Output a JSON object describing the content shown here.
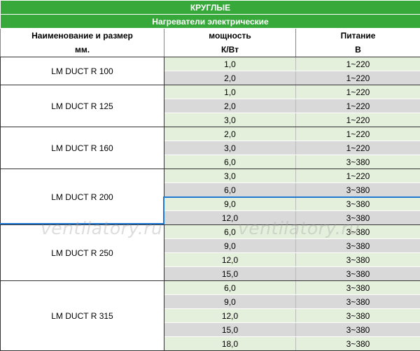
{
  "title": "КРУГЛЫЕ",
  "subtitle": "Нагреватели электрические",
  "headers": {
    "name_line1": "Наименование и размер",
    "name_line2": "мм.",
    "power_line1": "мощность",
    "power_line2": "К/Вт",
    "supply_line1": "Питание",
    "supply_line2": "В"
  },
  "groups": [
    {
      "name": "LM DUCT R 100",
      "rows": [
        {
          "power": "1,0",
          "supply": "1~220"
        },
        {
          "power": "2,0",
          "supply": "1~220"
        }
      ]
    },
    {
      "name": "LM DUCT R 125",
      "rows": [
        {
          "power": "1,0",
          "supply": "1~220"
        },
        {
          "power": "2,0",
          "supply": "1~220"
        },
        {
          "power": "3,0",
          "supply": "1~220"
        }
      ]
    },
    {
      "name": "LM DUCT R 160",
      "rows": [
        {
          "power": "2,0",
          "supply": "1~220"
        },
        {
          "power": "3,0",
          "supply": "1~220"
        },
        {
          "power": "6,0",
          "supply": "3~380"
        }
      ]
    },
    {
      "name": "LM DUCT R 200",
      "rows": [
        {
          "power": "3,0",
          "supply": "1~220"
        },
        {
          "power": "6,0",
          "supply": "3~380"
        },
        {
          "power": "9,0",
          "supply": "3~380"
        },
        {
          "power": "12,0",
          "supply": "3~380"
        }
      ]
    },
    {
      "name": "LM DUCT R 250",
      "rows": [
        {
          "power": "6,0",
          "supply": "3~380"
        },
        {
          "power": "9,0",
          "supply": "3~380"
        },
        {
          "power": "12,0",
          "supply": "3~380"
        },
        {
          "power": "15,0",
          "supply": "3~380"
        }
      ]
    },
    {
      "name": "LM DUCT R 315",
      "rows": [
        {
          "power": "6,0",
          "supply": "3~380"
        },
        {
          "power": "9,0",
          "supply": "3~380"
        },
        {
          "power": "12,0",
          "supply": "3~380"
        },
        {
          "power": "15,0",
          "supply": "3~380"
        },
        {
          "power": "18,0",
          "supply": "3~380"
        }
      ]
    }
  ],
  "watermark": "ventilatory.ru",
  "colors": {
    "header_green": "#37a93b",
    "row_green": "#e5f0dc",
    "row_gray": "#d9d9d9",
    "highlight_blue": "#1e78d2"
  }
}
